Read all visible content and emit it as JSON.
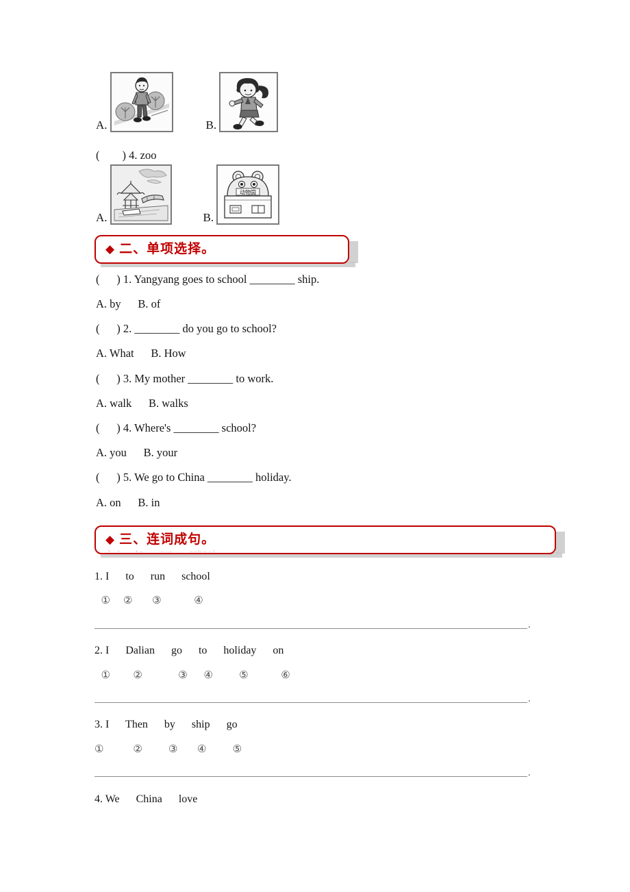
{
  "document": {
    "type": "worksheet",
    "language": "en-zh",
    "page_background": "#ffffff"
  },
  "listening_section": {
    "question_4": {
      "prefix": "(",
      "suffix": ") 4. zoo",
      "full_text": "(        ) 4. zoo"
    },
    "row1": {
      "option_a_label": "A.",
      "option_b_label": "B.",
      "option_a_icon": "boy-walking-on-path-picture",
      "option_b_icon": "girl-running-picture"
    },
    "row2": {
      "option_a_label": "A.",
      "option_b_label": "B.",
      "option_a_icon": "park-pavilion-picture",
      "option_b_icon": "zoo-building-picture",
      "zoo_sign_text": "动物园"
    }
  },
  "section_two": {
    "diamond": "◆",
    "title": "二、单项选择。",
    "color": "#C00000",
    "questions": [
      {
        "stem": "(      ) 1. Yangyang goes to school ________ ship.",
        "options": "A. by      B. of"
      },
      {
        "stem": "(      ) 2. ________ do you go to school?",
        "options": "A. What      B. How"
      },
      {
        "stem": "(      ) 3. My mother ________ to work.",
        "options": "A. walk      B. walks"
      },
      {
        "stem": "(      ) 4. Where's ________ school?",
        "options": "A. you      B. your"
      },
      {
        "stem": "(      ) 5. We go to China ________ holiday.",
        "options": "A. on      B. in"
      }
    ]
  },
  "section_three": {
    "diamond": "◆",
    "title": "三、连词成句。",
    "color": "#C00000",
    "items": [
      {
        "words": "1. I      to      run      school",
        "numbers": "  ①    ②      ③          ④",
        "answer_line": true,
        "end_punctuation": "."
      },
      {
        "words": "2. I      Dalian      go      to      holiday      on",
        "numbers": "  ①       ②           ③     ④        ⑤          ⑥",
        "answer_line": true,
        "end_punctuation": "."
      },
      {
        "words": "3. I      Then      by      ship      go",
        "numbers": "①         ②        ③      ④        ⑤",
        "answer_line": true,
        "end_punctuation": "."
      },
      {
        "words": "4. We      China      love",
        "numbers": "",
        "answer_line": false,
        "end_punctuation": ""
      }
    ]
  }
}
